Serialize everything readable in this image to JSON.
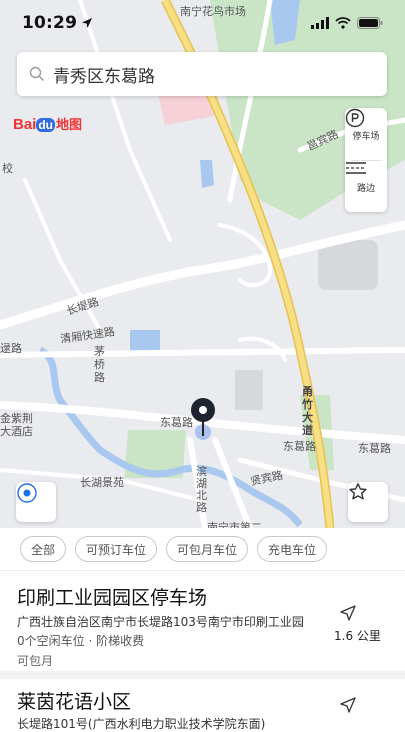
{
  "status_bar": {
    "time": "10:29"
  },
  "search": {
    "query": "青秀区东葛路"
  },
  "map": {
    "labels": {
      "top": "南宁花鸟市场",
      "binjiang": "邕宾路",
      "changdi": "长堤路",
      "qingxiu": "清厢快速路",
      "maoqiao": "茅桥路",
      "donggeLeft": "东葛路",
      "donggeMid": "东葛路",
      "donggeRight": "东葛路",
      "yongzhu": "甬竹大道",
      "binhu": "滨湖北路",
      "xianbin": "贤宾路",
      "changhu": "长湖景苑",
      "shiluLeft": "逯路",
      "hotel": "金紫荆\n大酒店",
      "school": "校",
      "bottom": "南宁市第二"
    },
    "tools": {
      "parking": "停车场",
      "roadside": "路边"
    }
  },
  "logo": {
    "text_bai": "Bai",
    "text_du": "du",
    "text_map": "地图"
  },
  "filters": [
    "全部",
    "可预订车位",
    "可包月车位",
    "充电车位"
  ],
  "list": [
    {
      "name": "印刷工业园园区停车场",
      "address": "广西壮族自治区南宁市长堤路103号南宁市印刷工业园",
      "detail": "0个空闲车位 · 阶梯收费",
      "tag": "可包月",
      "distance": "1.6 公里"
    },
    {
      "name": "莱茵花语小区",
      "address": "长堤路101号(广西水利电力职业技术学院东面)",
      "detail": "",
      "tag": "",
      "distance": ""
    }
  ],
  "colors": {
    "accent": "#1f6fe5",
    "park_green": "#cfe8cf",
    "highway": "#f3d774",
    "water": "#a9c8f0"
  }
}
